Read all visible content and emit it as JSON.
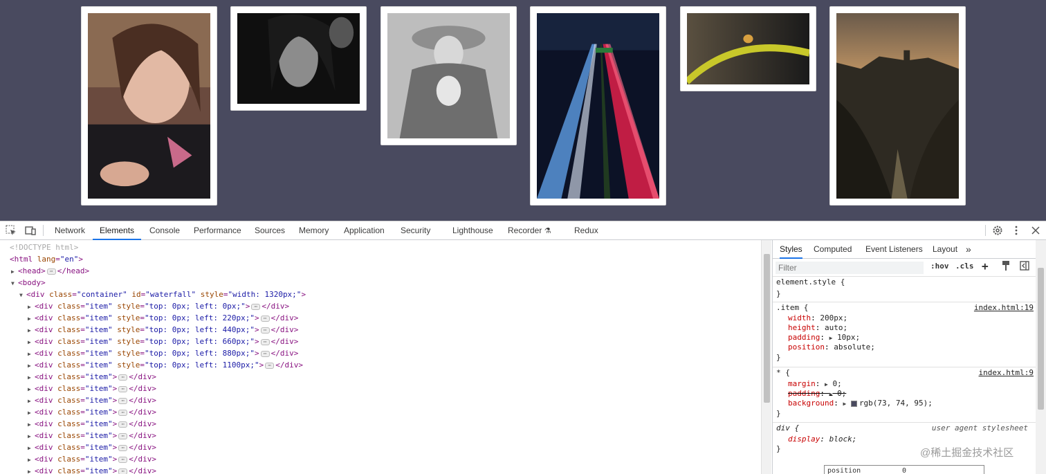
{
  "page": {
    "background_color": "#494a5f",
    "photos": [
      {
        "name": "photo-girl",
        "desc": "girl-portrait"
      },
      {
        "name": "photo-woman-bw",
        "desc": "woman-bw"
      },
      {
        "name": "photo-elder-child",
        "desc": "elder-child-bw"
      },
      {
        "name": "photo-highway",
        "desc": "highway-night"
      },
      {
        "name": "photo-frog",
        "desc": "frog-branch"
      },
      {
        "name": "photo-castle",
        "desc": "castle-valley"
      }
    ]
  },
  "devtools": {
    "tabs": [
      "Network",
      "Elements",
      "Console",
      "Performance",
      "Sources",
      "Memory",
      "Application",
      "Security",
      "Lighthouse",
      "Recorder",
      "Redux"
    ],
    "active_tab": "Elements",
    "icons": {
      "inspect": "inspect-icon",
      "device": "device-toggle-icon",
      "settings": "gear-icon",
      "more": "more-vertical-icon",
      "close": "close-icon",
      "recorder": "flask-icon"
    },
    "dom": {
      "doctype": "<!DOCTYPE html>",
      "html_open": {
        "tag": "html",
        "attr": "lang",
        "value": "\"en\""
      },
      "head": {
        "tag": "head",
        "close": "</head>"
      },
      "body": {
        "tag": "body"
      },
      "container": {
        "tag": "div",
        "class_attr": "class",
        "class_val": "\"container\"",
        "id_attr": "id",
        "id_val": "\"waterfall\"",
        "style_attr": "style",
        "style_val": "\"width: 1320px;\""
      },
      "positioned_items": [
        {
          "style": "\"top: 0px; left: 0px;\""
        },
        {
          "style": "\"top: 0px; left: 220px;\""
        },
        {
          "style": "\"top: 0px; left: 440px;\""
        },
        {
          "style": "\"top: 0px; left: 660px;\""
        },
        {
          "style": "\"top: 0px; left: 880px;\""
        },
        {
          "style": "\"top: 0px; left: 1100px;\""
        }
      ],
      "plain_item_count_visible": 9,
      "item_tag": "div",
      "item_class_attr": "class",
      "item_class_val": "\"item\"",
      "item_style_attr": "style",
      "close_tag": "</div>"
    },
    "styles_pane": {
      "tabs": [
        "Styles",
        "Computed",
        "Event Listeners",
        "Layout"
      ],
      "active_tab": "Styles",
      "filter_placeholder": "Filter",
      "hov": ":hov",
      "cls": ".cls",
      "rules": [
        {
          "selector": "element.style {",
          "close": "}",
          "props": []
        },
        {
          "selector": ".item {",
          "source": "index.html:19",
          "close": "}",
          "props": [
            {
              "name": "width",
              "value": "200px;"
            },
            {
              "name": "height",
              "value": "auto;"
            },
            {
              "name": "padding",
              "value": "10px;"
            },
            {
              "name": "position",
              "value": "absolute;"
            }
          ]
        },
        {
          "selector": "* {",
          "source": "index.html:9",
          "close": "}",
          "props": [
            {
              "name": "margin",
              "value": "0;"
            },
            {
              "name": "padding",
              "value": "0;"
            },
            {
              "name": "background",
              "value": "rgb(73, 74, 95);"
            }
          ]
        },
        {
          "selector": "div {",
          "source": "user agent stylesheet",
          "close": "}",
          "props": [
            {
              "name": "display",
              "value": "block;"
            }
          ]
        }
      ],
      "box_model_label": "position",
      "box_model_value": "0"
    }
  },
  "watermark": "@稀土掘金技术社区"
}
